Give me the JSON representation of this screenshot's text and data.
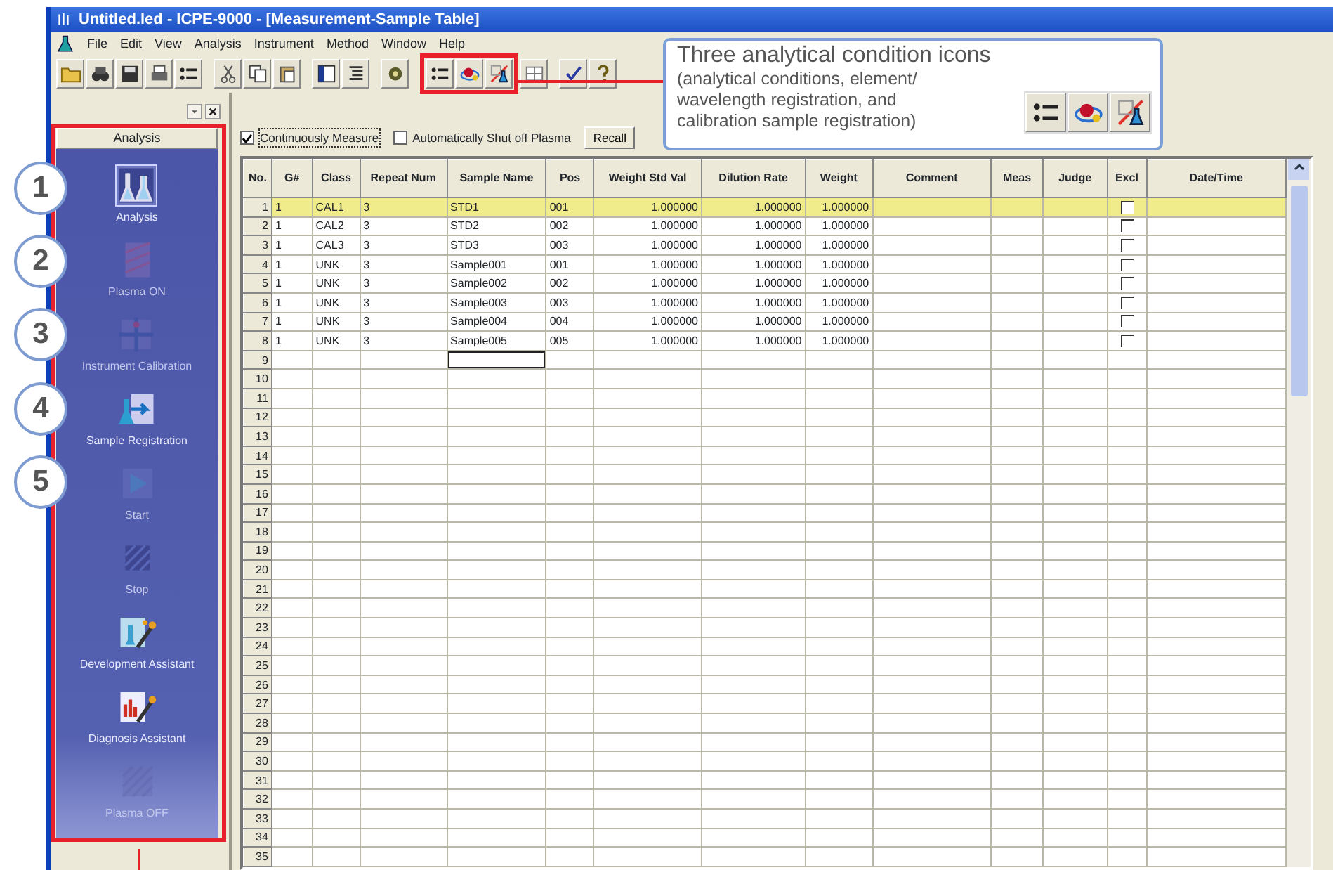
{
  "window": {
    "title": "Untitled.led - ICPE-9000 - [Measurement-Sample Table]"
  },
  "menu": [
    "File",
    "Edit",
    "View",
    "Analysis",
    "Instrument",
    "Method",
    "Window",
    "Help"
  ],
  "sidebar": {
    "title": "Analysis",
    "items": [
      {
        "label": "Analysis",
        "selected": true,
        "disabled": false
      },
      {
        "label": "Plasma ON",
        "selected": false,
        "disabled": true
      },
      {
        "label": "Instrument Calibration",
        "selected": false,
        "disabled": true
      },
      {
        "label": "Sample Registration",
        "selected": false,
        "disabled": false
      },
      {
        "label": "Start",
        "selected": false,
        "disabled": true
      },
      {
        "label": "Stop",
        "selected": false,
        "disabled": true
      },
      {
        "label": "Development Assistant",
        "selected": false,
        "disabled": false
      },
      {
        "label": "Diagnosis Assistant",
        "selected": false,
        "disabled": false
      },
      {
        "label": "Plasma OFF",
        "selected": false,
        "disabled": true
      }
    ]
  },
  "options": [
    {
      "label": "Continuously Measure",
      "checked": true
    },
    {
      "label": "Automatically Shut off Plasma",
      "checked": false
    }
  ],
  "recall_button": "Recall",
  "table": {
    "columns": [
      "No.",
      "G#",
      "Class",
      "Repeat Num",
      "Sample Name",
      "Pos",
      "Weight Std Val",
      "Dilution Rate",
      "Weight",
      "Comment",
      "Meas",
      "Judge",
      "Excl",
      "Date/Time"
    ],
    "rows": [
      {
        "no": "1",
        "selected": true,
        "cells": [
          "1",
          "CAL1",
          "3",
          "STD1",
          "001",
          "1.000000",
          "1.000000",
          "1.000000"
        ],
        "excl": false
      },
      {
        "no": "2",
        "selected": false,
        "cells": [
          "1",
          "CAL2",
          "3",
          "STD2",
          "002",
          "1.000000",
          "1.000000",
          "1.000000"
        ],
        "excl": false
      },
      {
        "no": "3",
        "selected": false,
        "cells": [
          "1",
          "CAL3",
          "3",
          "STD3",
          "003",
          "1.000000",
          "1.000000",
          "1.000000"
        ],
        "excl": false
      },
      {
        "no": "4",
        "selected": false,
        "cells": [
          "1",
          "UNK",
          "3",
          "Sample001",
          "001",
          "1.000000",
          "1.000000",
          "1.000000"
        ],
        "excl": false
      },
      {
        "no": "5",
        "selected": false,
        "cells": [
          "1",
          "UNK",
          "3",
          "Sample002",
          "002",
          "1.000000",
          "1.000000",
          "1.000000"
        ],
        "excl": false
      },
      {
        "no": "6",
        "selected": false,
        "cells": [
          "1",
          "UNK",
          "3",
          "Sample003",
          "003",
          "1.000000",
          "1.000000",
          "1.000000"
        ],
        "excl": false
      },
      {
        "no": "7",
        "selected": false,
        "cells": [
          "1",
          "UNK",
          "3",
          "Sample004",
          "004",
          "1.000000",
          "1.000000",
          "1.000000"
        ],
        "excl": false
      },
      {
        "no": "8",
        "selected": false,
        "cells": [
          "1",
          "UNK",
          "3",
          "Sample005",
          "005",
          "1.000000",
          "1.000000",
          "1.000000"
        ],
        "excl": false
      },
      {
        "no": "9",
        "selected": false,
        "editing": true
      },
      {
        "no": "10",
        "selected": false
      },
      {
        "no": "11",
        "selected": false
      },
      {
        "no": "12",
        "selected": false
      },
      {
        "no": "13",
        "selected": false
      },
      {
        "no": "14",
        "selected": false
      },
      {
        "no": "15",
        "selected": false
      },
      {
        "no": "16",
        "selected": false
      },
      {
        "no": "17",
        "selected": false
      },
      {
        "no": "18",
        "selected": false
      },
      {
        "no": "19",
        "selected": false
      },
      {
        "no": "20",
        "selected": false
      },
      {
        "no": "21",
        "selected": false
      },
      {
        "no": "22",
        "selected": false
      },
      {
        "no": "23",
        "selected": false
      },
      {
        "no": "24",
        "selected": false
      },
      {
        "no": "25",
        "selected": false
      },
      {
        "no": "26",
        "selected": false
      },
      {
        "no": "27",
        "selected": false
      },
      {
        "no": "28",
        "selected": false
      },
      {
        "no": "29",
        "selected": false
      },
      {
        "no": "30",
        "selected": false
      },
      {
        "no": "31",
        "selected": false
      },
      {
        "no": "32",
        "selected": false
      },
      {
        "no": "33",
        "selected": false
      },
      {
        "no": "34",
        "selected": false
      },
      {
        "no": "35",
        "selected": false
      }
    ]
  },
  "callout": {
    "title": "Three analytical condition icons",
    "text": "(analytical conditions, element/ wavelength registration, and calibration sample registration)"
  },
  "step_markers": [
    "1",
    "2",
    "3",
    "4",
    "5"
  ]
}
